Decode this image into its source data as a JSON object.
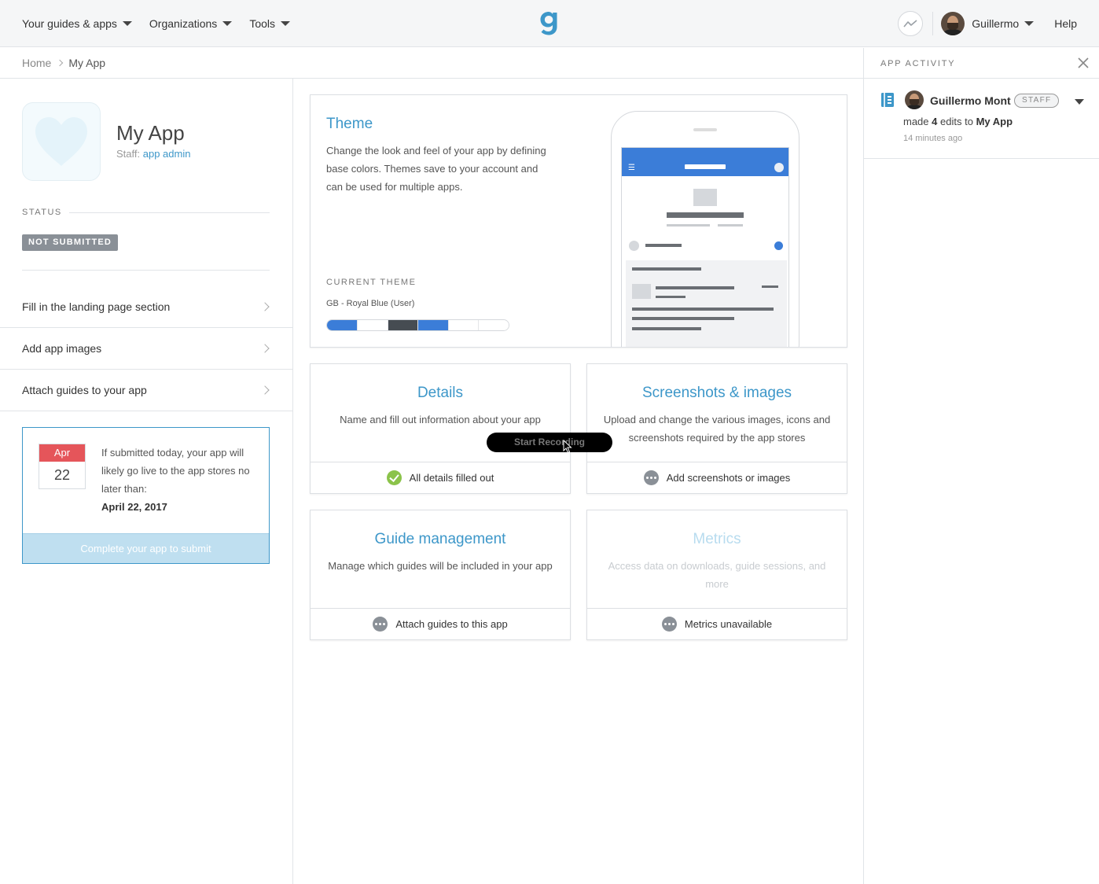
{
  "nav": {
    "items": [
      {
        "label": "Your guides & apps"
      },
      {
        "label": "Organizations"
      },
      {
        "label": "Tools"
      }
    ],
    "user_name": "Guillermo",
    "help": "Help"
  },
  "breadcrumb": {
    "home": "Home",
    "current": "My App"
  },
  "app": {
    "title": "My App",
    "staff_prefix": "Staff:",
    "staff_role": "app admin"
  },
  "status": {
    "label": "STATUS",
    "badge": "NOT SUBMITTED"
  },
  "tasks": [
    {
      "label": "Fill in the landing page section"
    },
    {
      "label": "Add app images"
    },
    {
      "label": "Attach guides to your app"
    }
  ],
  "submit": {
    "month": "Apr",
    "day": "22",
    "text": "If submitted today, your app will likely go live to the app stores no later than:",
    "date": "April 22, 2017",
    "button": "Complete your app to submit"
  },
  "theme": {
    "title": "Theme",
    "description": "Change the look and feel of your app by defining base colors. Themes save to your account and can be used for multiple apps.",
    "current_label": "CURRENT THEME",
    "current_value": "GB - Royal Blue (User)",
    "swatches": [
      "#3b7dd8",
      "#ffffff",
      "#464c52",
      "#3b7dd8",
      "#ffffff",
      "#ffffff"
    ]
  },
  "cards": {
    "details": {
      "title": "Details",
      "description": "Name and fill out information about your app",
      "footer": "All details filled out"
    },
    "screenshots": {
      "title": "Screenshots & images",
      "description": "Upload and change the various images, icons and screenshots required by the app stores",
      "footer": "Add screenshots or images"
    },
    "guides": {
      "title": "Guide management",
      "description": "Manage which guides will be included in your app",
      "footer": "Attach guides to this app"
    },
    "metrics": {
      "title": "Metrics",
      "description": "Access data on downloads, guide sessions, and more",
      "footer": "Metrics unavailable"
    }
  },
  "overlay": {
    "recording": "Start Recording"
  },
  "activity": {
    "title": "APP ACTIVITY",
    "user": "Guillermo Mont",
    "badge": "STAFF",
    "text_made": "made",
    "count": "4",
    "text_edits": "edits to",
    "target": "My App",
    "time": "14 minutes ago"
  },
  "colors": {
    "accent": "#3d97c9",
    "badge_gray": "#8a9097",
    "calendar_red": "#e5555a",
    "success": "#8bc34a"
  }
}
